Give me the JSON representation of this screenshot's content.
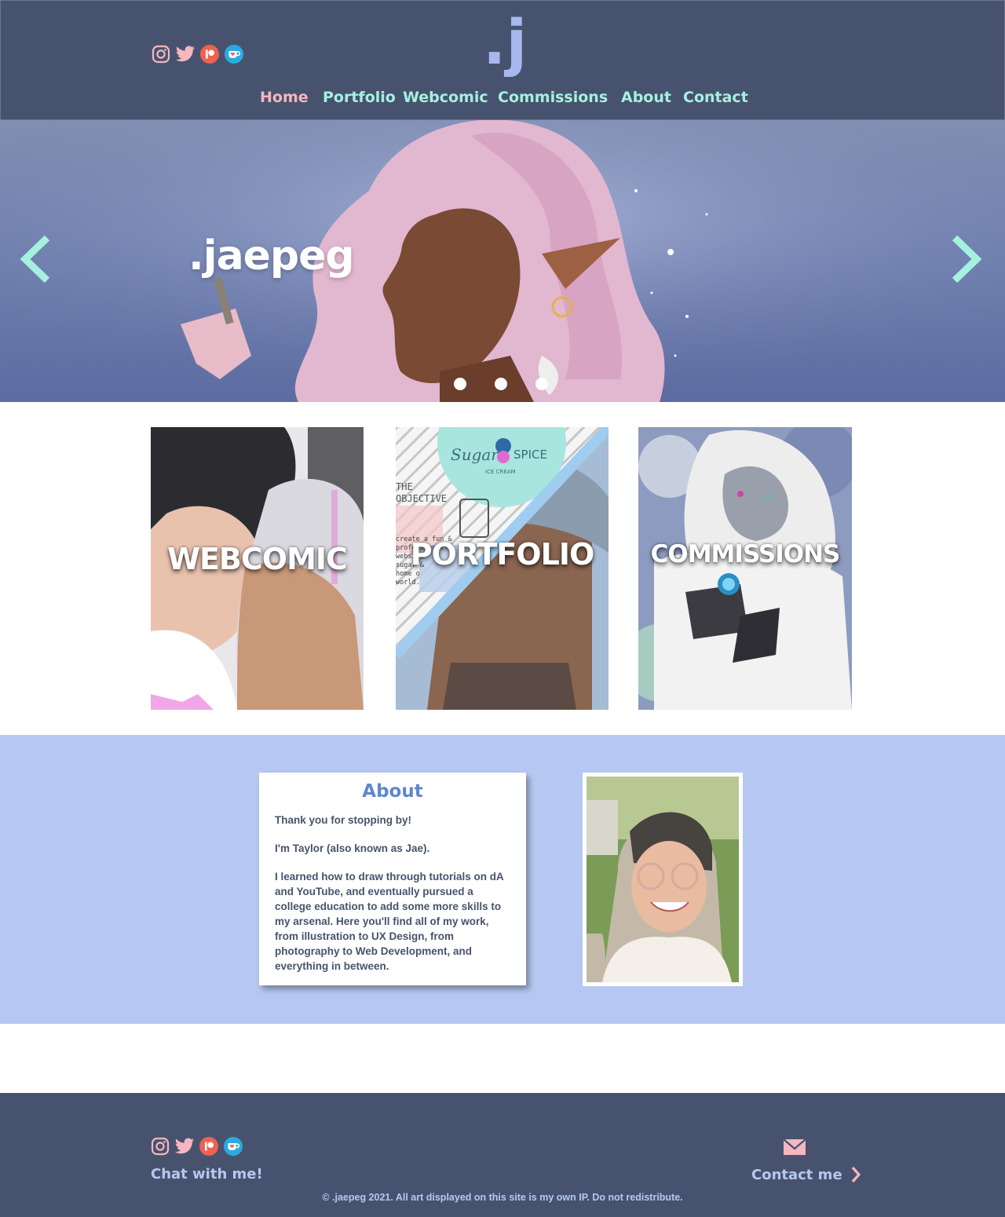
{
  "colors": {
    "header_bg": "#47536e",
    "nav_active": "#f6b6c0",
    "nav_default": "#a6f0df",
    "logo": "#a7b8ee",
    "about_band": "#b6c8f1",
    "about_heading": "#5f86cf",
    "footer_text": "#b6c8f1",
    "arrow": "#a6f0df"
  },
  "header": {
    "logo_text": ".j",
    "social_icons": [
      "instagram-icon",
      "twitter-icon",
      "patreon-icon",
      "kofi-icon"
    ],
    "nav": [
      {
        "label": "Home",
        "active": true
      },
      {
        "label": "Portfolio",
        "active": false
      },
      {
        "label": "Webcomic",
        "active": false
      },
      {
        "label": "Commissions",
        "active": false
      },
      {
        "label": "About",
        "active": false
      },
      {
        "label": "Contact",
        "active": false
      }
    ]
  },
  "hero": {
    "title": ".jaepeg",
    "prev_icon": "chevron-left-icon",
    "next_icon": "chevron-right-icon",
    "slide_count": 3
  },
  "tiles": [
    {
      "label": "WEBCOMIC"
    },
    {
      "label": "PORTFOLIO",
      "sign_title": "Sugar",
      "sign_title2": "SPICE",
      "sign_sub": "ICE CREAM",
      "objective_heading": "THE\nOBJECTIVE",
      "objective_text": "create a fun &\nprofessional\nwebsite\nsugar &\nhome o\nworld."
    },
    {
      "label": "COMMISSIONS"
    }
  ],
  "about": {
    "heading": "About",
    "paragraphs": [
      "Thank you for stopping by!",
      "I'm Taylor (also known as Jae).",
      "I learned how to draw through tutorials on dA and YouTube, and eventually pursued a college education to add some more skills to my arsenal. Here you'll find all of my work, from illustration to UX Design, from photography to Web Development, and everything in between."
    ]
  },
  "footer": {
    "social_icons": [
      "instagram-icon",
      "twitter-icon",
      "patreon-icon",
      "kofi-icon"
    ],
    "chat_label": "Chat with me!",
    "contact_label": "Contact me",
    "mail_icon": "mail-icon",
    "copyright": "© .jaepeg 2021. All art displayed on this site is my own IP. Do not redistribute."
  }
}
